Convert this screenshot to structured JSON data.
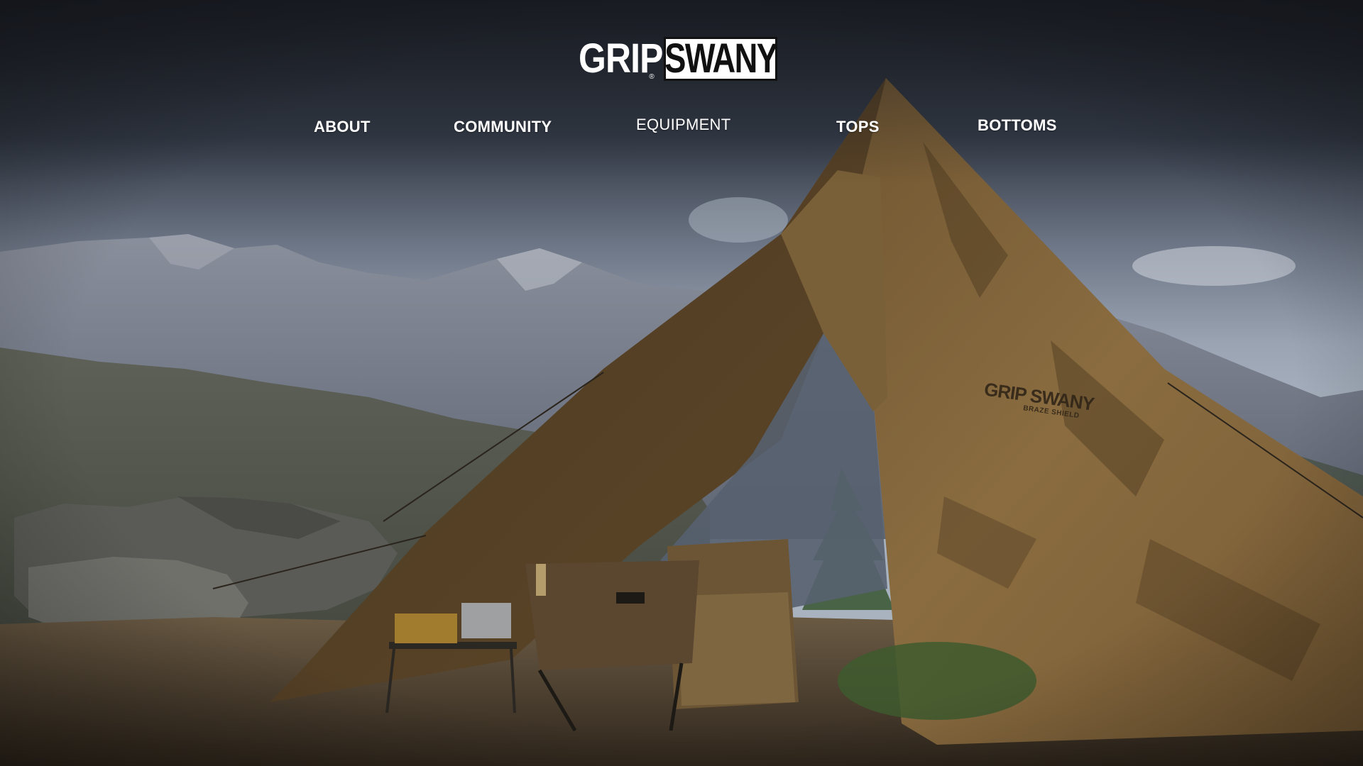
{
  "brand": {
    "logo_text_left": "GRIP",
    "logo_text_right": "SWANY",
    "logo_registered": "®"
  },
  "nav": {
    "items": [
      {
        "label": "ABOUT"
      },
      {
        "label": "COMMUNITY"
      },
      {
        "label": "EQUIPMENT"
      },
      {
        "label": "TOPS"
      },
      {
        "label": "BOTTOMS"
      }
    ]
  },
  "hero": {
    "tent_print_brand": "GRIP SWANY",
    "tent_print_model": "BRAZE SHIELD"
  },
  "colors": {
    "nav_text": "#ffffff",
    "tent_tan": "#8a6a3e",
    "tent_shadow": "#4e3a22",
    "sky_top": "#23272f",
    "mountain": "#5b6270"
  },
  "icons": []
}
